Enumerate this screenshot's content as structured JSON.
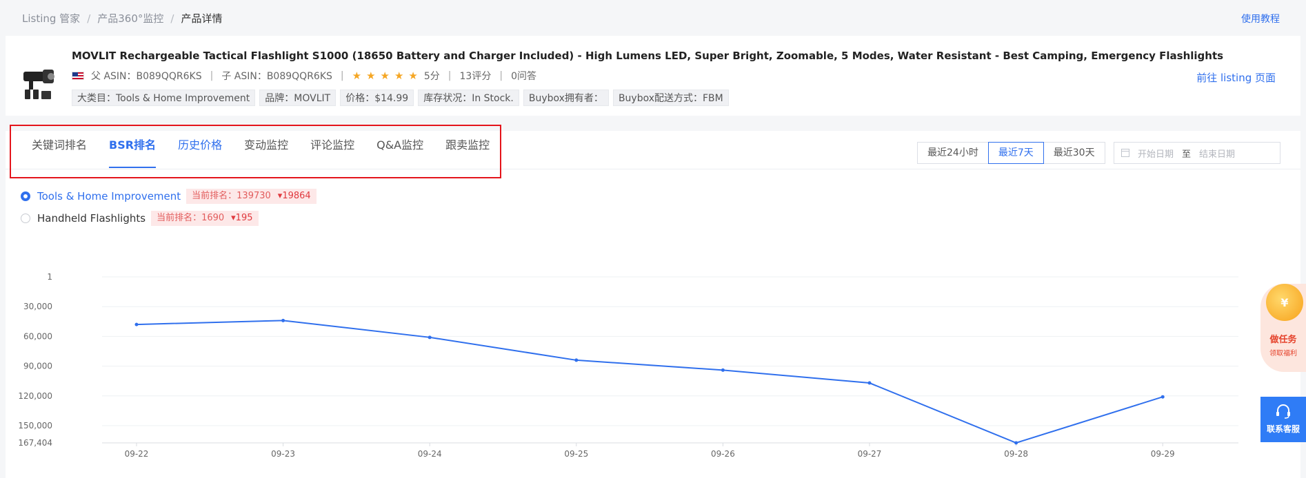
{
  "breadcrumb": {
    "items": [
      "Listing 管家",
      "产品360°监控",
      "产品详情"
    ],
    "separator": "/"
  },
  "header": {
    "tutorial_link": "使用教程"
  },
  "product": {
    "title": "MOVLIT Rechargeable Tactical Flashlight S1000 (18650 Battery and Charger Included) - High Lumens LED, Super Bright, Zoomable, 5 Modes, Water Resistant - Best Camping, Emergency Flashlights",
    "parent_asin": "父 ASIN：B089QQR6KS",
    "child_asin": "子 ASIN：B089QQR6KS",
    "rating_stars": 5,
    "rating_text": "5分",
    "reviews": "13评分",
    "qa": "0问答",
    "tags": [
      "大类目：Tools & Home Improvement",
      "品牌：MOVLIT",
      "价格：$14.99",
      "库存状况：In Stock.",
      "Buybox拥有者：",
      "Buybox配送方式：FBM"
    ],
    "goto_listing": "前往 listing 页面",
    "thumbnail_icon": "flashlight-icon"
  },
  "tabs": [
    {
      "label": "关键词排名",
      "state": "normal"
    },
    {
      "label": "BSR排名",
      "state": "active"
    },
    {
      "label": "历史价格",
      "state": "link"
    },
    {
      "label": "变动监控",
      "state": "normal"
    },
    {
      "label": "评论监控",
      "state": "normal"
    },
    {
      "label": "Q&A监控",
      "state": "normal"
    },
    {
      "label": "跟卖监控",
      "state": "normal"
    }
  ],
  "range_buttons": [
    {
      "label": "最近24小时",
      "active": false
    },
    {
      "label": "最近7天",
      "active": true
    },
    {
      "label": "最近30天",
      "active": false
    }
  ],
  "date_range": {
    "start_placeholder": "开始日期",
    "separator": "至",
    "end_placeholder": "结束日期"
  },
  "categories": [
    {
      "name": "Tools & Home Improvement",
      "checked": true,
      "rank_label": "当前排名：139730",
      "change": "▾19864"
    },
    {
      "name": "Handheld Flashlights",
      "checked": false,
      "rank_label": "当前排名：1690",
      "change": "▾195"
    }
  ],
  "chart_data": {
    "type": "line",
    "x": [
      "09-22",
      "09-23",
      "09-24",
      "09-25",
      "09-26",
      "09-27",
      "09-28",
      "09-29"
    ],
    "series": [
      {
        "values": [
          48000,
          44000,
          61000,
          84000,
          94000,
          107000,
          167404,
          121000
        ],
        "color": "#2f6fed"
      }
    ],
    "y_ticks": [
      1,
      30000,
      60000,
      90000,
      120000,
      150000,
      167404
    ],
    "y_tick_labels": [
      "1",
      "30,000",
      "60,000",
      "90,000",
      "120,000",
      "150,000",
      "167,404"
    ],
    "ylim": [
      1,
      167404
    ],
    "y_inverted": true,
    "grid": true
  },
  "task_widget": {
    "title": "做任务",
    "subtitle": "领取福利",
    "coin_symbol": "¥"
  },
  "service_widget": {
    "label": "联系客服",
    "icon": "headset-icon"
  },
  "colors": {
    "accent": "#2f6fed",
    "highlight_border": "#e4141b",
    "badge_bg": "#fde8e8",
    "badge_text": "#e25c5c"
  }
}
